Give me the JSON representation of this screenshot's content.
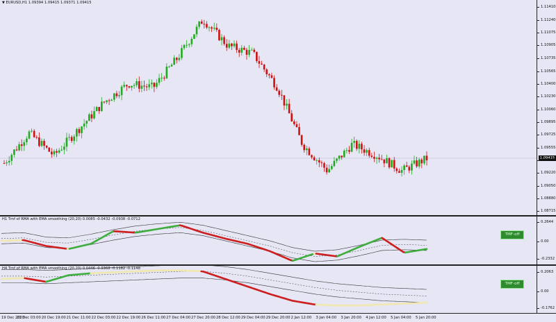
{
  "chart_data": [
    {
      "type": "line",
      "title": "EURUSD,H1  1.09394 1.09415 1.09371 1.09415",
      "series": [
        {
          "x": [
            "19 Dec 2023",
            "20 Dec 03:00",
            "20 Dec 19:00",
            "21 Dec 11:00",
            "22 Dec 03:00",
            "22 Dec 19:00",
            "26 Dec 11:00",
            "27 Dec 04:00",
            "27 Dec 20:00",
            "28 Dec 12:00",
            "29 Dec 04:00",
            "29 Dec 20:00",
            "2 Jan 12:00",
            "3 Jan 04:00",
            "3 Jan 20:00",
            "4 Jan 12:00",
            "5 Jan 04:00",
            "5 Jan 20:00"
          ],
          "values": [
            1.0935,
            1.0975,
            1.0945,
            1.098,
            1.1015,
            1.104,
            1.1035,
            1.1075,
            1.1125,
            1.109,
            1.108,
            1.1035,
            1.096,
            1.0925,
            1.096,
            1.0945,
            1.0925,
            1.0941
          ]
        }
      ],
      "ytick_labels": [
        "1.11410",
        "1.11240",
        "1.11075",
        "1.10905",
        "1.10735",
        "1.10565",
        "1.10400",
        "1.10230",
        "1.10060",
        "1.09895",
        "1.09725",
        "1.09555",
        "1.09385",
        "1.09220",
        "1.09050",
        "1.08880",
        "1.08715"
      ],
      "current_price": "1.09415",
      "ylim": [
        1.087,
        1.1145
      ]
    },
    {
      "type": "line",
      "title": "H1 Tmf of RMA with EMA smoothing (20,20) 0.0085 -0.0432 -0.0938 -0.0712",
      "ytick_labels": [
        "0.2644",
        "0.00",
        "-0.2332"
      ],
      "series": [
        {
          "values": [
            0.01,
            0.02,
            -0.06,
            -0.1,
            -0.03,
            0.14,
            0.12,
            0.17,
            0.22,
            0.12,
            0.04,
            -0.03,
            -0.13,
            -0.26,
            -0.16,
            -0.2,
            -0.07,
            0.05,
            -0.15,
            -0.1
          ]
        },
        {
          "values": [
            0.04,
            0.05,
            -0.01,
            -0.02,
            0.03,
            0.09,
            0.14,
            0.17,
            0.19,
            0.15,
            0.08,
            0.01,
            -0.06,
            -0.15,
            -0.2,
            -0.18,
            -0.12,
            -0.05,
            -0.04,
            -0.05
          ]
        }
      ],
      "ylim": [
        -0.27,
        0.3
      ],
      "status_button": "TMF-off"
    },
    {
      "type": "line",
      "title": "H4 Tmf of RMA with EMA smoothing (20,20) 0.0446 -0.0368 -0.1182 -0.1148",
      "ytick_labels": [
        "0.2063",
        "0.00",
        "-0.1762"
      ],
      "series": [
        {
          "values": [
            0.13,
            0.14,
            0.1,
            0.17,
            0.19,
            0.2,
            0.21,
            0.22,
            0.22,
            0.21,
            0.13,
            0.05,
            -0.03,
            -0.1,
            -0.14,
            -0.15,
            -0.15,
            -0.14,
            -0.13,
            -0.12
          ]
        },
        {
          "values": [
            0.16,
            0.16,
            0.15,
            0.16,
            0.17,
            0.18,
            0.19,
            0.2,
            0.21,
            0.21,
            0.19,
            0.16,
            0.12,
            0.08,
            0.04,
            0.01,
            -0.01,
            -0.03,
            -0.04,
            -0.05
          ]
        }
      ],
      "ylim": [
        -0.2,
        0.24
      ],
      "status_button": "TMF-off"
    }
  ],
  "time_axis": [
    "19 Dec 2023",
    "20 Dec 03:00",
    "20 Dec 19:00",
    "21 Dec 11:00",
    "22 Dec 03:00",
    "22 Dec 19:00",
    "26 Dec 11:00",
    "27 Dec 04:00",
    "27 Dec 20:00",
    "28 Dec 12:00",
    "29 Dec 04:00",
    "29 Dec 20:00",
    "2 Jan 12:00",
    "3 Jan 04:00",
    "3 Jan 20:00",
    "4 Jan 12:00",
    "5 Jan 04:00",
    "5 Jan 20:00"
  ],
  "colors": {
    "bull": "#22aa22",
    "bear": "#cc1111",
    "tmf_up": "#3fae3f",
    "tmf_down": "#cc2020",
    "tmf_neutral": "#f0e8b0",
    "band": "#333333",
    "background": "#e6e6f5"
  },
  "window": {
    "dropdown_icon": "triangle-down-icon"
  }
}
